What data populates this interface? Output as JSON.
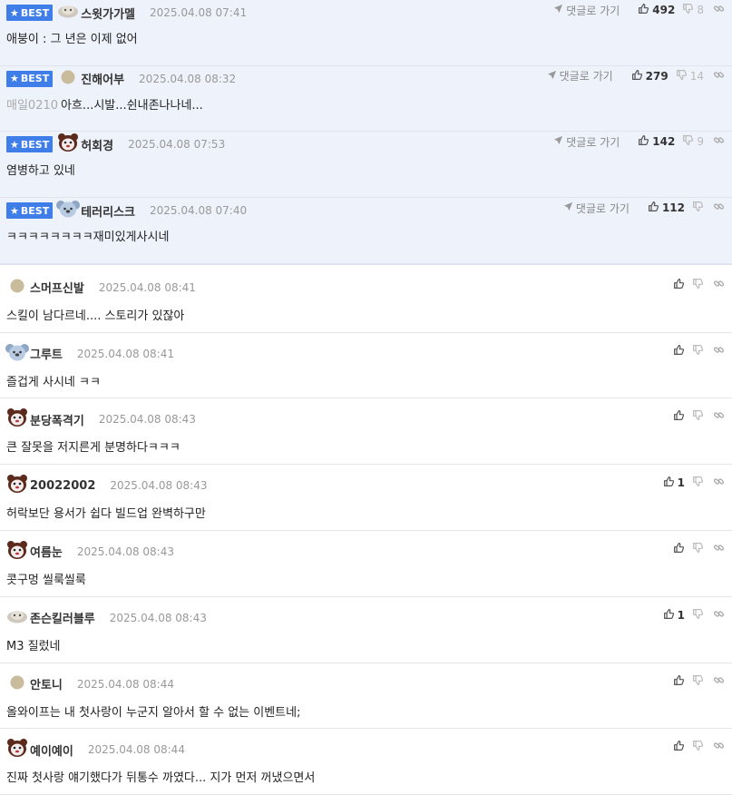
{
  "labels": {
    "best": "BEST",
    "reply": "댓글로 가기"
  },
  "colors": {
    "best_bg": "#eef2fb",
    "badge": "#3f7ee8"
  },
  "best_comments": [
    {
      "avatar": "ghost-icon",
      "nick": "스윗가가멜",
      "date": "2025.04.08 07:41",
      "mention": "",
      "text": "애붕이 : 그 년은 이제 없어",
      "up": "492",
      "down": "8"
    },
    {
      "avatar": "dot-icon",
      "nick": "진해어부",
      "date": "2025.04.08 08:32",
      "mention": "매일0210",
      "text": "아흐...시발...쉰내존나나네...",
      "up": "279",
      "down": "14"
    },
    {
      "avatar": "bear-icon",
      "nick": "허회경",
      "date": "2025.04.08 07:53",
      "mention": "",
      "text": "염병하고 있네",
      "up": "142",
      "down": "9"
    },
    {
      "avatar": "koala-icon",
      "nick": "테러리스크",
      "date": "2025.04.08 07:40",
      "mention": "",
      "text": "ㅋㅋㅋㅋㅋㅋㅋㅋ재미있게사시네",
      "up": "112",
      "down": ""
    }
  ],
  "comments": [
    {
      "avatar": "dot-icon",
      "nick": "스머프신발",
      "date": "2025.04.08 08:41",
      "text": "스킬이 남다르네.... 스토리가 있잖아",
      "up": ""
    },
    {
      "avatar": "koala-icon",
      "nick": "그루트",
      "date": "2025.04.08 08:41",
      "text": "즐겁게 사시네 ㅋㅋ",
      "up": ""
    },
    {
      "avatar": "bear-icon",
      "nick": "분당폭격기",
      "date": "2025.04.08 08:43",
      "text": "큰 잘못을 저지른게 분명하다ㅋㅋㅋ",
      "up": ""
    },
    {
      "avatar": "bear-icon",
      "nick": "20022002",
      "date": "2025.04.08 08:43",
      "text": "허락보단 용서가 쉽다 빌드업 완벽하구만",
      "up": "1"
    },
    {
      "avatar": "bear-icon",
      "nick": "여름눈",
      "date": "2025.04.08 08:43",
      "text": "콧구멍 씰룩씰룩",
      "up": ""
    },
    {
      "avatar": "ghost-icon",
      "nick": "존슨킬러블루",
      "date": "2025.04.08 08:43",
      "text": "M3 질렀네",
      "up": "1"
    },
    {
      "avatar": "dot-icon",
      "nick": "안토니",
      "date": "2025.04.08 08:44",
      "text": "올와이프는 내 첫사랑이 누군지 알아서 할 수 없는 이벤트네;",
      "up": ""
    },
    {
      "avatar": "bear-icon",
      "nick": "예이예이",
      "date": "2025.04.08 08:44",
      "text": "진짜 첫사랑 얘기했다가 뒤통수 까였다... 지가 먼저 꺼냈으면서",
      "up": ""
    }
  ]
}
